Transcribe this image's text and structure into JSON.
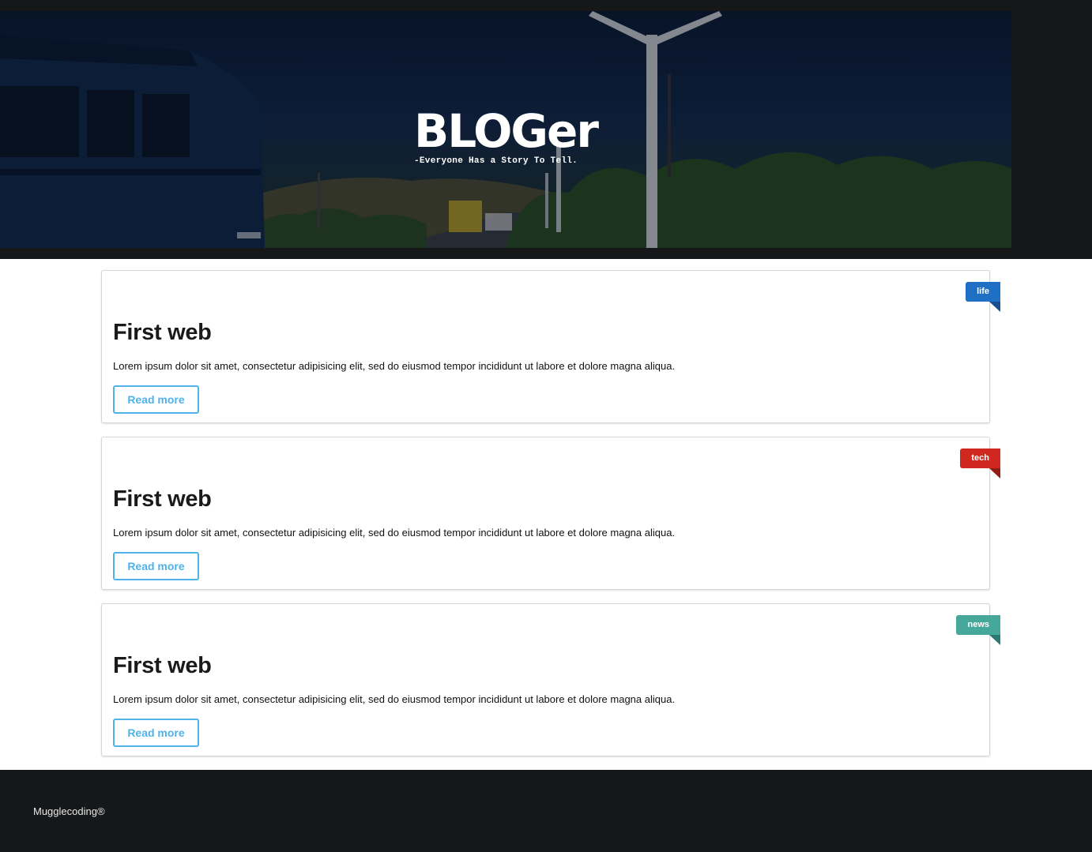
{
  "header": {
    "title": "BLOGer",
    "tagline": "-Everyone Has a Story To Tell."
  },
  "posts": [
    {
      "title": "First web",
      "excerpt": "Lorem ipsum dolor sit amet, consectetur adipisicing elit, sed do eiusmod tempor incididunt ut labore et dolore magna aliqua.",
      "button_label": "Read more",
      "tag": "life",
      "tag_color": "#1f6fc5",
      "tag_fold_color": "#164f8f"
    },
    {
      "title": "First web",
      "excerpt": "Lorem ipsum dolor sit amet, consectetur adipisicing elit, sed do eiusmod tempor incididunt ut labore et dolore magna aliqua.",
      "button_label": "Read more",
      "tag": "tech",
      "tag_color": "#d0281f",
      "tag_fold_color": "#951b15"
    },
    {
      "title": "First web",
      "excerpt": "Lorem ipsum dolor sit amet, consectetur adipisicing elit, sed do eiusmod tempor incididunt ut labore et dolore magna aliqua.",
      "button_label": "Read more",
      "tag": "news",
      "tag_color": "#46a79b",
      "tag_fold_color": "#2d7a70"
    }
  ],
  "footer": {
    "text": "Mugglecoding®"
  },
  "colors": {
    "dark_band": "#151718",
    "accent_button": "#4fb3ea"
  }
}
